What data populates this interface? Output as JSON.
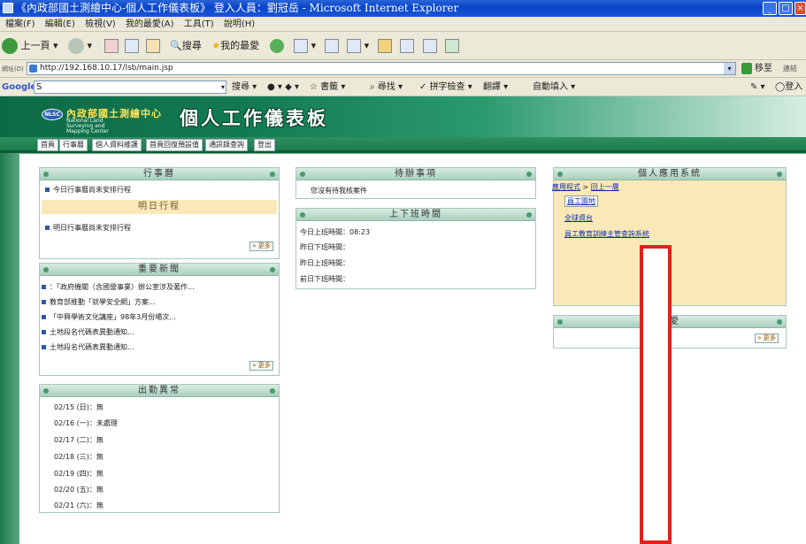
{
  "window": {
    "title": "《內政部國土測繪中心-個人工作儀表板》 登入人員：劉冠岳 - Microsoft Internet Explorer"
  },
  "menu": [
    "檔案(F)",
    "編輯(E)",
    "檢視(V)",
    "我的最愛(A)",
    "工具(T)",
    "說明(H)"
  ],
  "toolbar": {
    "back_label": "上一頁",
    "search_label": "搜尋",
    "favorites_label": "我的最愛"
  },
  "address": {
    "label": "網址(D)",
    "url": "http://192.168.10.17/lsb/main.jsp",
    "go_label": "移至",
    "links_label": "連結"
  },
  "googlebar": {
    "brand": "Google",
    "query": "S",
    "items": [
      "搜尋",
      "書籤",
      "尋找",
      "拼字檢查",
      "翻譯",
      "自動填入"
    ],
    "signin": "登入"
  },
  "banner": {
    "org_name": "內政部國土測繪中心",
    "org_sub": "National Land Surveying and Mapping Center",
    "logo_text": "NLSC",
    "big_title": "個人工作儀表板"
  },
  "nav": [
    "首頁",
    "行事曆",
    "個人資料維護",
    "首頁回復預設值",
    "通訊錄查詢",
    "登出"
  ],
  "calendar": {
    "title": "行事曆",
    "today_text": "今日行事曆尚未安排行程",
    "tomorrow_title": "明日行程",
    "tomorrow_text": "明日行事曆尚未安排行程",
    "more": "更多"
  },
  "news": {
    "title": "重要新聞",
    "items": [
      "：「政府機關（含國營事業）辦公室涉及著作...",
      "教育部推動「就學安全網」方案...",
      "「中興學術文化講座」98年3月份場次...",
      "土地段名代碼表異動通知...",
      "土地段名代碼表異動通知..."
    ],
    "more": "更多"
  },
  "attendance": {
    "title": "出勤異常",
    "items": [
      "02/15 (日)：無",
      "02/16 (一)：未處理",
      "02/17 (二)：無",
      "02/18 (三)：無",
      "02/19 (四)：無",
      "02/20 (五)：無",
      "02/21 (六)：無"
    ]
  },
  "todo": {
    "title": "待辦事項",
    "text": "您沒有待我核案件"
  },
  "worktime": {
    "title": "上下班時間",
    "items": [
      "今日上班時間：08:23",
      "昨日下班時間：",
      "昨日上班時間：",
      "前日下班時間："
    ]
  },
  "apps": {
    "title": "個人應用系統",
    "breadcrumb_root": "應用程式",
    "breadcrumb_sep": ">",
    "breadcrumb_up": "回上一層",
    "links": [
      "員工園地",
      "全球資台",
      "員工教育訓練主管查詢系統"
    ]
  },
  "favorites": {
    "title": "最愛",
    "more": "更多"
  },
  "colors": {
    "banner_green": "#127a52",
    "highlight_red": "#e0221d",
    "apps_bg": "#fbe8b8"
  }
}
